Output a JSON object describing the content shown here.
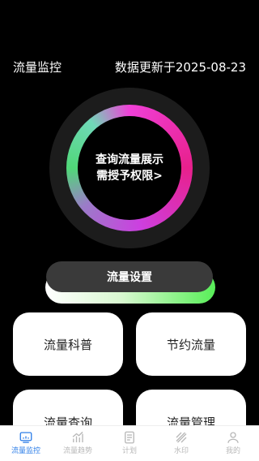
{
  "header": {
    "title": "流量监控",
    "update_text": "数据更新于2025-08-23"
  },
  "ring": {
    "line1": "查询流量展示",
    "line2": "需授予权限>"
  },
  "settings_button": "流量设置",
  "cards": [
    {
      "label": "流量科普"
    },
    {
      "label": "节约流量"
    },
    {
      "label": "流量查询"
    },
    {
      "label": "流量管理"
    }
  ],
  "tabbar": {
    "active_index": 0,
    "active_color": "#2f7fe8",
    "inactive_color": "#b8b8b8",
    "tabs": [
      {
        "label": "流量监控",
        "icon": "monitor-icon"
      },
      {
        "label": "流量趋势",
        "icon": "bar-chart-icon"
      },
      {
        "label": "计划",
        "icon": "document-icon"
      },
      {
        "label": "水印",
        "icon": "watermark-icon"
      },
      {
        "label": "我的",
        "icon": "person-icon"
      }
    ]
  },
  "colors": {
    "background": "#000000",
    "ring_track": "#1c1c1c",
    "settings_button": "#3a3a3a",
    "accent_green": "#58ee58",
    "accent_pink": "#e8208c"
  }
}
